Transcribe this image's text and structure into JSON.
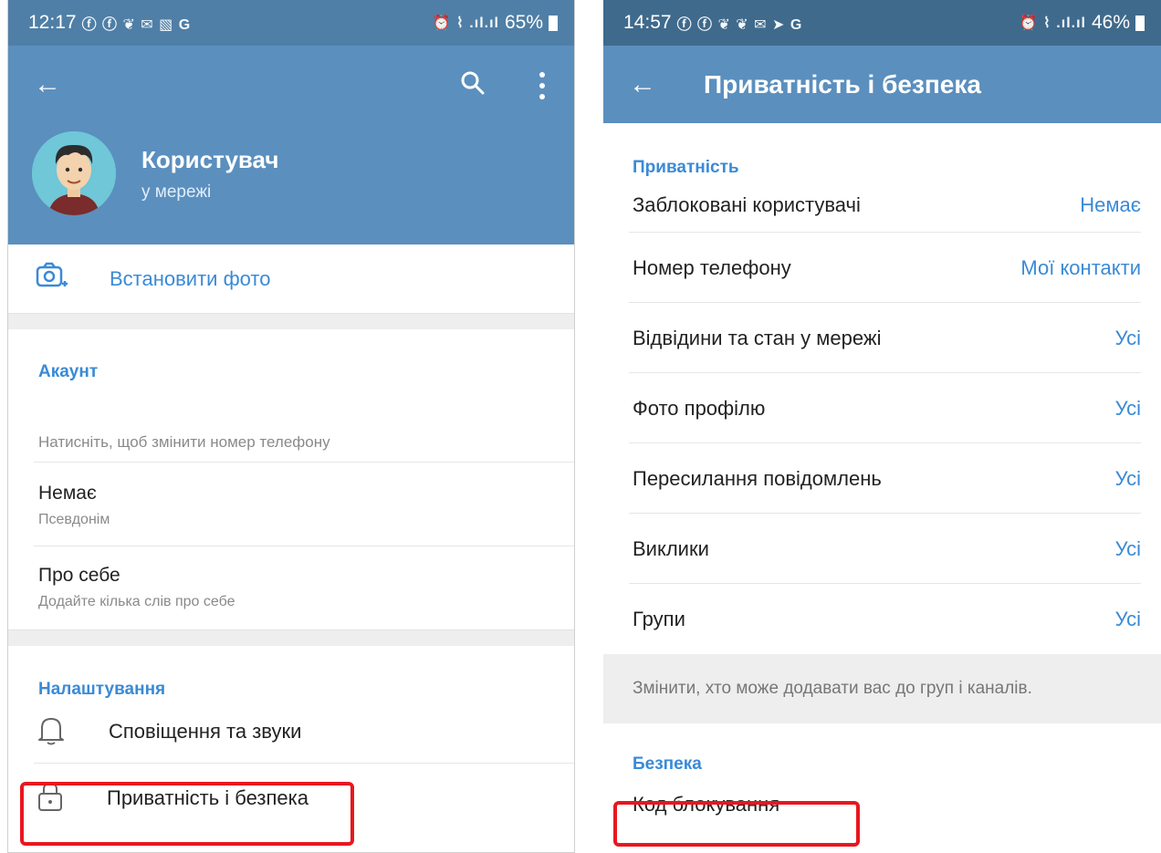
{
  "left": {
    "statusbar": {
      "time": "12:17",
      "notif_icons": "ⓕ ⓕ ❦ ✉ ▧ G",
      "right_icons": "⏰ ⌇ .ıl.ıl",
      "battery": "65%"
    },
    "profile": {
      "name": "Користувач",
      "status": "у мережі"
    },
    "set_photo_label": "Встановити фото",
    "account": {
      "title": "Акаунт",
      "phone_hint": "Натисніть, щоб змінити номер телефону",
      "username_value": "Немає",
      "username_caption": "Псевдонім",
      "bio_title": "Про себе",
      "bio_hint": "Додайте кілька слів про себе"
    },
    "settings": {
      "title": "Налаштування",
      "items": [
        {
          "label": "Сповіщення та звуки",
          "icon": "bell-icon"
        },
        {
          "label": "Приватність і безпека",
          "icon": "lock-icon"
        }
      ]
    }
  },
  "right": {
    "statusbar": {
      "time": "14:57",
      "notif_icons": "ⓕ ⓕ ❦ ❦ ✉ ➤ G",
      "right_icons": "⏰ ⌇ .ıl.ıl",
      "battery": "46%"
    },
    "title": "Приватність і безпека",
    "privacy": {
      "title": "Приватність",
      "items": [
        {
          "label": "Заблоковані користувачі",
          "value": "Немає"
        },
        {
          "label": "Номер телефону",
          "value": "Мої контакти"
        },
        {
          "label": "Відвідини та стан у мережі",
          "value": "Усі"
        },
        {
          "label": "Фото профілю",
          "value": "Усі"
        },
        {
          "label": "Пересилання повідомлень",
          "value": "Усі"
        },
        {
          "label": "Виклики",
          "value": "Усі"
        },
        {
          "label": "Групи",
          "value": "Усі"
        }
      ],
      "footer": "Змінити, хто може додавати вас до груп і каналів."
    },
    "security": {
      "title": "Безпека",
      "first_item": "Код блокування"
    }
  },
  "colors": {
    "header": "#5b8fbe",
    "statusbar_left": "#4f7fa6",
    "statusbar_right": "#3f6a8c",
    "accent": "#3a8ad6",
    "highlight": "#e8171f"
  }
}
